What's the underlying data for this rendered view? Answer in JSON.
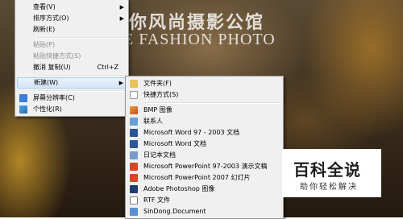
{
  "watermark": {
    "line1": "你风尚摄影公馆",
    "line2": "E FASHION PHOTO"
  },
  "context_menu": {
    "items": [
      {
        "label": "查看(V)",
        "submenu": true,
        "disabled": false
      },
      {
        "label": "排序方式(O)",
        "submenu": true,
        "disabled": false
      },
      {
        "label": "刷新(E)",
        "submenu": false,
        "disabled": false
      },
      {
        "label": "粘贴(P)",
        "submenu": false,
        "disabled": true
      },
      {
        "label": "粘贴快捷方式(S)",
        "submenu": false,
        "disabled": true
      },
      {
        "label": "撤消 复制(U)",
        "shortcut": "Ctrl+Z",
        "submenu": false,
        "disabled": false
      },
      {
        "label": "新建(W)",
        "submenu": true,
        "disabled": false,
        "highlighted": true
      },
      {
        "label": "屏幕分辨率(C)",
        "submenu": false,
        "disabled": false
      },
      {
        "label": "个性化(R)",
        "submenu": false,
        "disabled": false
      }
    ]
  },
  "new_submenu": {
    "items": [
      {
        "label": "文件夹(F)",
        "icon": "folder-icon"
      },
      {
        "label": "快捷方式(S)",
        "icon": "shortcut-icon"
      },
      {
        "label": "BMP 图像",
        "icon": "bmp-icon"
      },
      {
        "label": "联系人",
        "icon": "contact-icon"
      },
      {
        "label": "Microsoft Word 97 - 2003 文档",
        "icon": "word-icon"
      },
      {
        "label": "Microsoft Word 文档",
        "icon": "word-icon"
      },
      {
        "label": "日记本文档",
        "icon": "journal-icon"
      },
      {
        "label": "Microsoft PowerPoint 97-2003 演示文稿",
        "icon": "powerpoint-icon"
      },
      {
        "label": "Microsoft PowerPoint 2007 幻灯片",
        "icon": "powerpoint-icon"
      },
      {
        "label": "Adobe Photoshop 图像",
        "icon": "photoshop-icon"
      },
      {
        "label": "RTF 文件",
        "icon": "rtf-icon"
      },
      {
        "label": "SinDong.Document",
        "icon": "document-icon"
      }
    ]
  },
  "brand": {
    "title": "百科全说",
    "subtitle": "助你轻松解决"
  },
  "colors": {
    "menu_bg": "#f0f0f0",
    "highlight": "#d4e6f8",
    "word": "#2b5797",
    "ppt": "#d24726",
    "ps": "#1c3d6e"
  }
}
